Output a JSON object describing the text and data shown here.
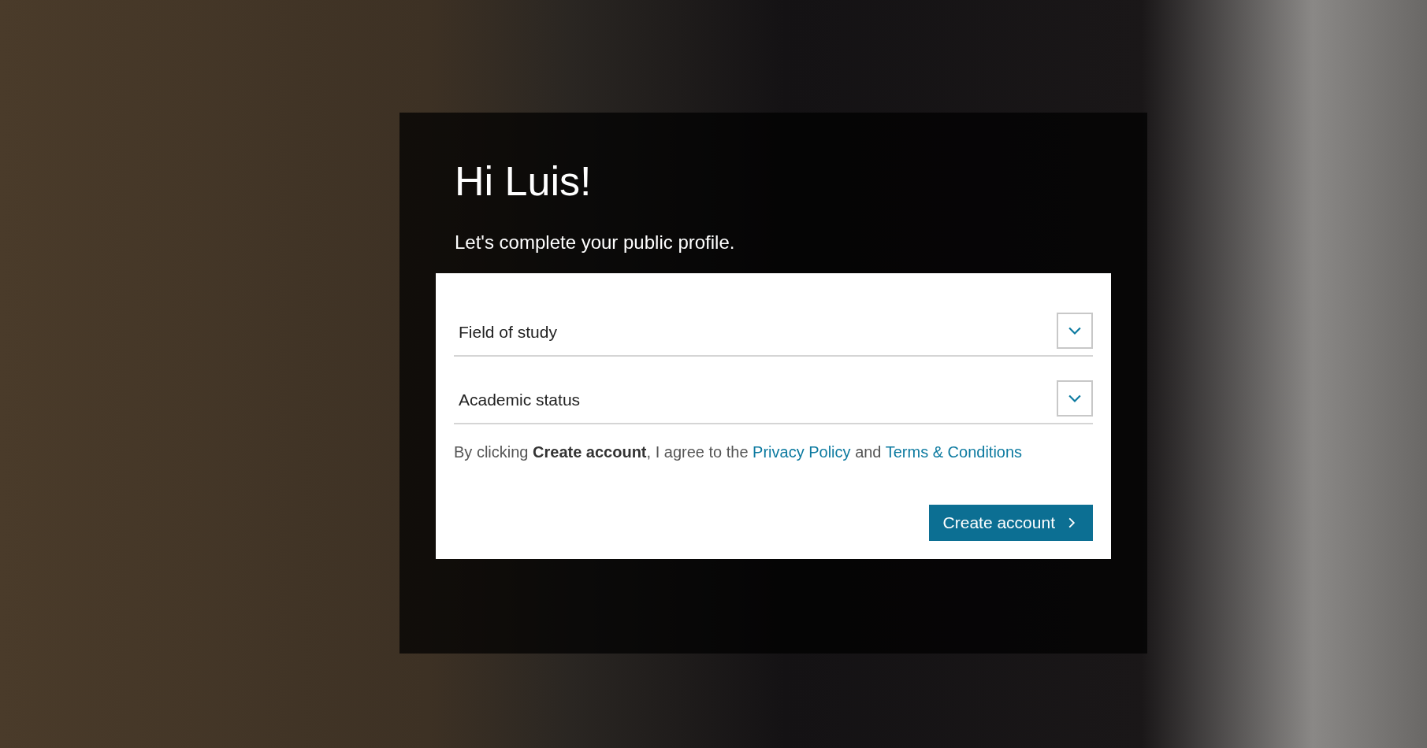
{
  "greeting": "Hi Luis!",
  "subtitle": "Let's complete your public profile.",
  "fields": [
    {
      "label": "Field of study"
    },
    {
      "label": "Academic status"
    }
  ],
  "consent": [
    {
      "kind": "text",
      "text": "By clicking **Create account**, I agree to the"
    },
    {
      "kind": "link",
      "text": "Privacy Policy"
    },
    {
      "kind": "text",
      "text": "and"
    },
    {
      "kind": "link",
      "text": "Terms & Conditions"
    }
  ],
  "submit": {
    "label": "Create account"
  }
}
